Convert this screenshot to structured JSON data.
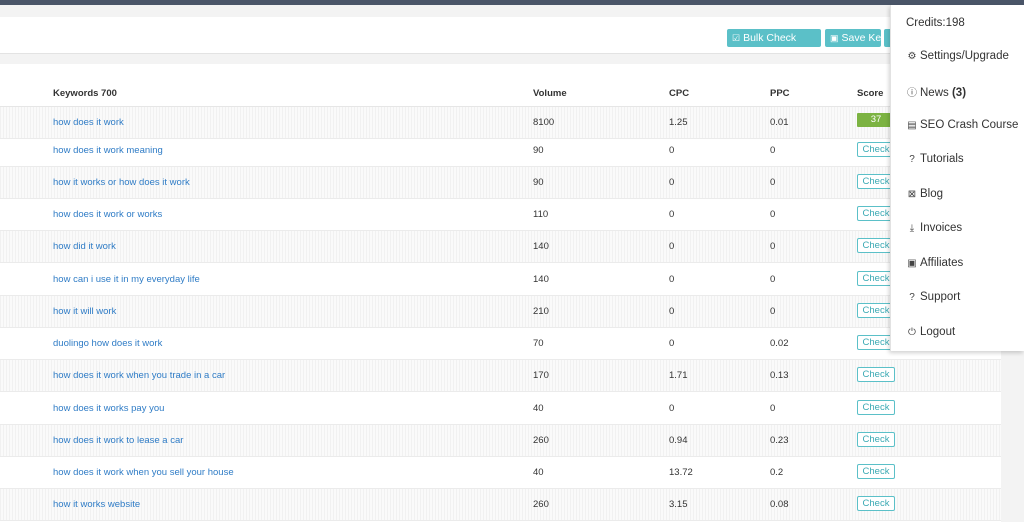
{
  "toolbar": {
    "bulk_check_label": "Bulk Check",
    "save_keywords_label": "Save Keywords"
  },
  "table": {
    "headers": {
      "keywords": "Keywords 700",
      "volume": "Volume",
      "cpc": "CPC",
      "ppc": "PPC",
      "score": "Score"
    },
    "check_label": "Check",
    "rows": [
      {
        "keyword": "how does it work",
        "volume": "8100",
        "cpc": "1.25",
        "ppc": "0.01",
        "score": "37"
      },
      {
        "keyword": "how does it work meaning",
        "volume": "90",
        "cpc": "0",
        "ppc": "0",
        "score": ""
      },
      {
        "keyword": "how it works or how does it work",
        "volume": "90",
        "cpc": "0",
        "ppc": "0",
        "score": ""
      },
      {
        "keyword": "how does it work or works",
        "volume": "110",
        "cpc": "0",
        "ppc": "0",
        "score": ""
      },
      {
        "keyword": "how did it work",
        "volume": "140",
        "cpc": "0",
        "ppc": "0",
        "score": ""
      },
      {
        "keyword": "how can i use it in my everyday life",
        "volume": "140",
        "cpc": "0",
        "ppc": "0",
        "score": ""
      },
      {
        "keyword": "how it will work",
        "volume": "210",
        "cpc": "0",
        "ppc": "0",
        "score": ""
      },
      {
        "keyword": "duolingo how does it work",
        "volume": "70",
        "cpc": "0",
        "ppc": "0.02",
        "score": ""
      },
      {
        "keyword": "how does it work when you trade in a car",
        "volume": "170",
        "cpc": "1.71",
        "ppc": "0.13",
        "score": ""
      },
      {
        "keyword": "how does it works pay you",
        "volume": "40",
        "cpc": "0",
        "ppc": "0",
        "score": ""
      },
      {
        "keyword": "how does it work to lease a car",
        "volume": "260",
        "cpc": "0.94",
        "ppc": "0.23",
        "score": ""
      },
      {
        "keyword": "how does it work when you sell your house",
        "volume": "40",
        "cpc": "13.72",
        "ppc": "0.2",
        "score": ""
      },
      {
        "keyword": "how it works website",
        "volume": "260",
        "cpc": "3.15",
        "ppc": "0.08",
        "score": ""
      }
    ]
  },
  "menu": {
    "credits": "Credits:198",
    "items": [
      {
        "icon": "gear-icon",
        "label": "Settings/Upgrade",
        "badge": ""
      },
      {
        "icon": "info-icon",
        "label": "News",
        "badge": "(3)"
      },
      {
        "icon": "book-icon",
        "label": "SEO Crash Course",
        "badge": ""
      },
      {
        "icon": "question-icon",
        "label": "Tutorials",
        "badge": ""
      },
      {
        "icon": "rss-icon",
        "label": "Blog",
        "badge": ""
      },
      {
        "icon": "download-icon",
        "label": "Invoices",
        "badge": ""
      },
      {
        "icon": "money-icon",
        "label": "Affiliates",
        "badge": ""
      },
      {
        "icon": "question-icon",
        "label": "Support",
        "badge": ""
      },
      {
        "icon": "power-icon",
        "label": "Logout",
        "badge": ""
      }
    ]
  },
  "colors": {
    "accent": "#5bc0c8",
    "link": "#2f7cc6",
    "score_green": "#7cb342"
  }
}
